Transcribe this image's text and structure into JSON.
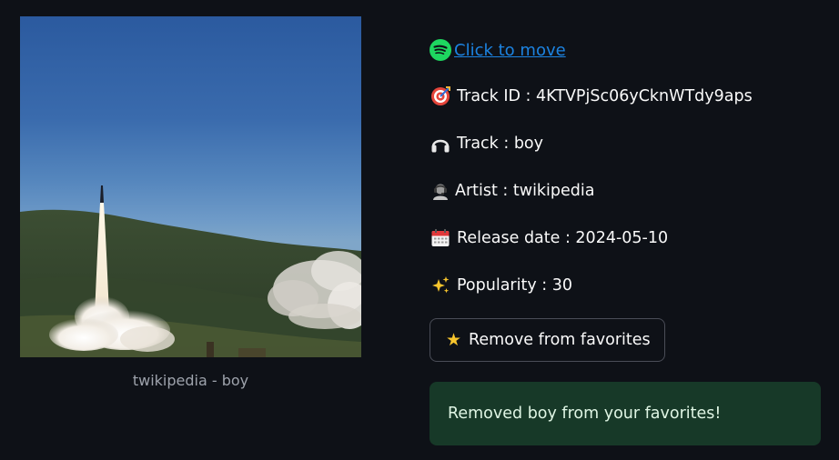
{
  "album": {
    "caption": "twikipedia - boy"
  },
  "details": {
    "spotify_link": "Click to move",
    "track_id_label": "Track ID : 4KTVPjSc06yCknWTdy9aps",
    "track_label": "Track : boy",
    "artist_label": "Artist : twikipedia",
    "release_label": "Release date : 2024-05-10",
    "popularity_label": "Popularity : 30"
  },
  "favorites_button": {
    "label": "Remove from favorites"
  },
  "alert": {
    "message": "Removed boy from your favorites!"
  },
  "icons": {
    "spotify": "spotify-icon",
    "track_id": "target-icon",
    "track": "headphones-icon",
    "artist": "artist-icon",
    "release": "calendar-icon",
    "popularity": "sparkles-icon",
    "button": "star-icon"
  },
  "colors": {
    "background": "#0e1117",
    "link": "#1c83e1",
    "spotify_green": "#1ed760",
    "success_bg": "#173928",
    "caption": "#9ea3ac"
  }
}
